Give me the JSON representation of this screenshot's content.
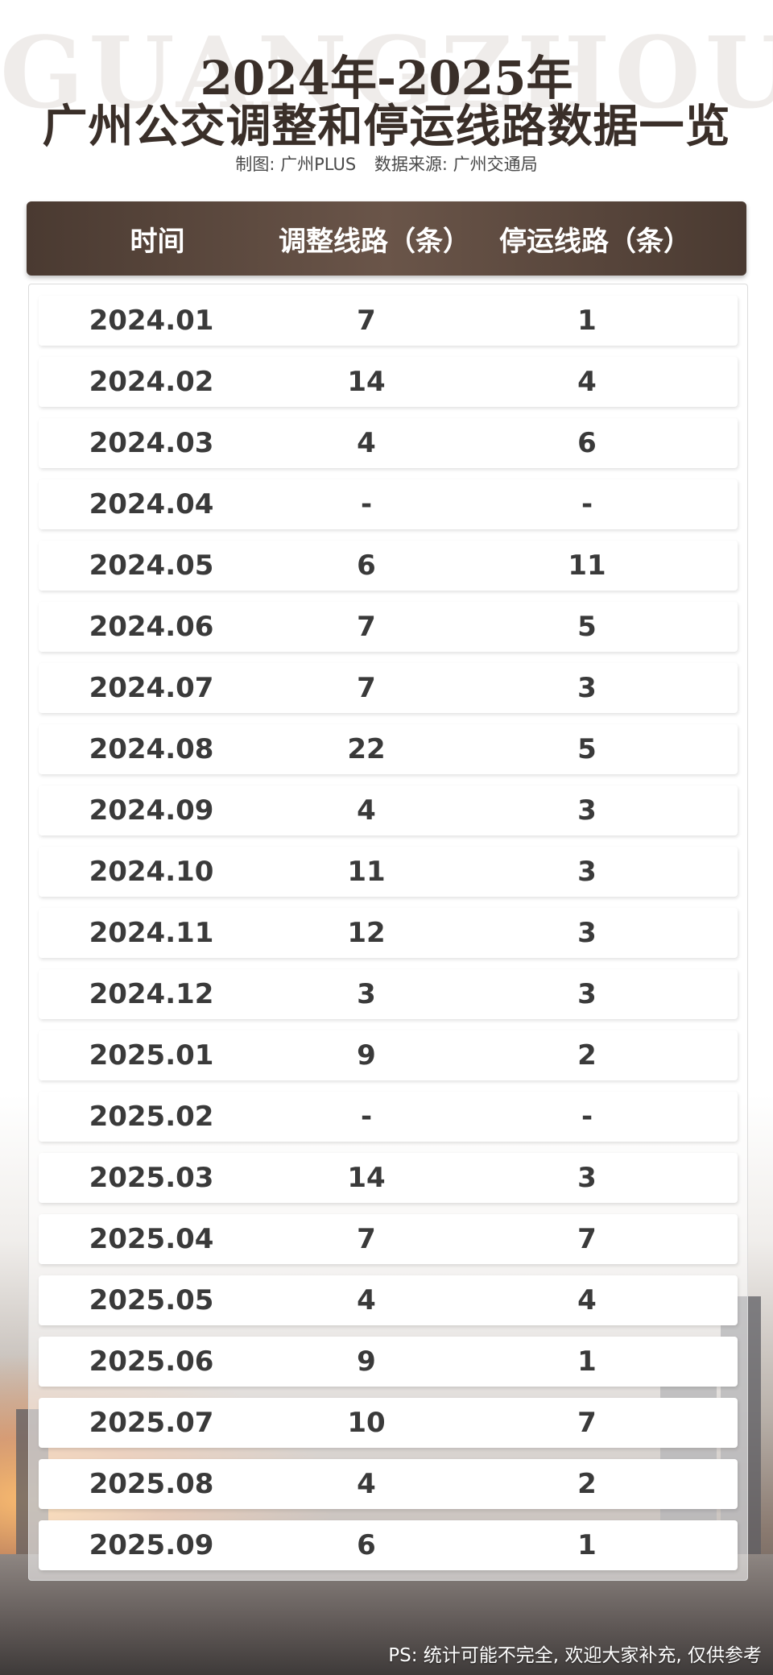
{
  "watermark": "GUANGZHOU",
  "title_line1": "2024年-2025年",
  "title_line2": "广州公交调整和停运线路数据一览",
  "credit": {
    "maker": "制图: 广州PLUS",
    "source": "数据来源: 广州交通局"
  },
  "table": {
    "headers": [
      "时间",
      "调整线路（条）",
      "停运线路（条）"
    ],
    "rows": [
      [
        "2024.01",
        "7",
        "1"
      ],
      [
        "2024.02",
        "14",
        "4"
      ],
      [
        "2024.03",
        "4",
        "6"
      ],
      [
        "2024.04",
        "-",
        "-"
      ],
      [
        "2024.05",
        "6",
        "11"
      ],
      [
        "2024.06",
        "7",
        "5"
      ],
      [
        "2024.07",
        "7",
        "3"
      ],
      [
        "2024.08",
        "22",
        "5"
      ],
      [
        "2024.09",
        "4",
        "3"
      ],
      [
        "2024.10",
        "11",
        "3"
      ],
      [
        "2024.11",
        "12",
        "3"
      ],
      [
        "2024.12",
        "3",
        "3"
      ],
      [
        "2025.01",
        "9",
        "2"
      ],
      [
        "2025.02",
        "-",
        "-"
      ],
      [
        "2025.03",
        "14",
        "3"
      ],
      [
        "2025.04",
        "7",
        "7"
      ],
      [
        "2025.05",
        "4",
        "4"
      ],
      [
        "2025.06",
        "9",
        "1"
      ],
      [
        "2025.07",
        "10",
        "7"
      ],
      [
        "2025.08",
        "4",
        "2"
      ],
      [
        "2025.09",
        "6",
        "1"
      ]
    ]
  },
  "footnote": "PS: 统计可能不完全, 欢迎大家补充, 仅供参考",
  "colors": {
    "header_bg": "#5a463b",
    "title": "#3a2f29"
  }
}
